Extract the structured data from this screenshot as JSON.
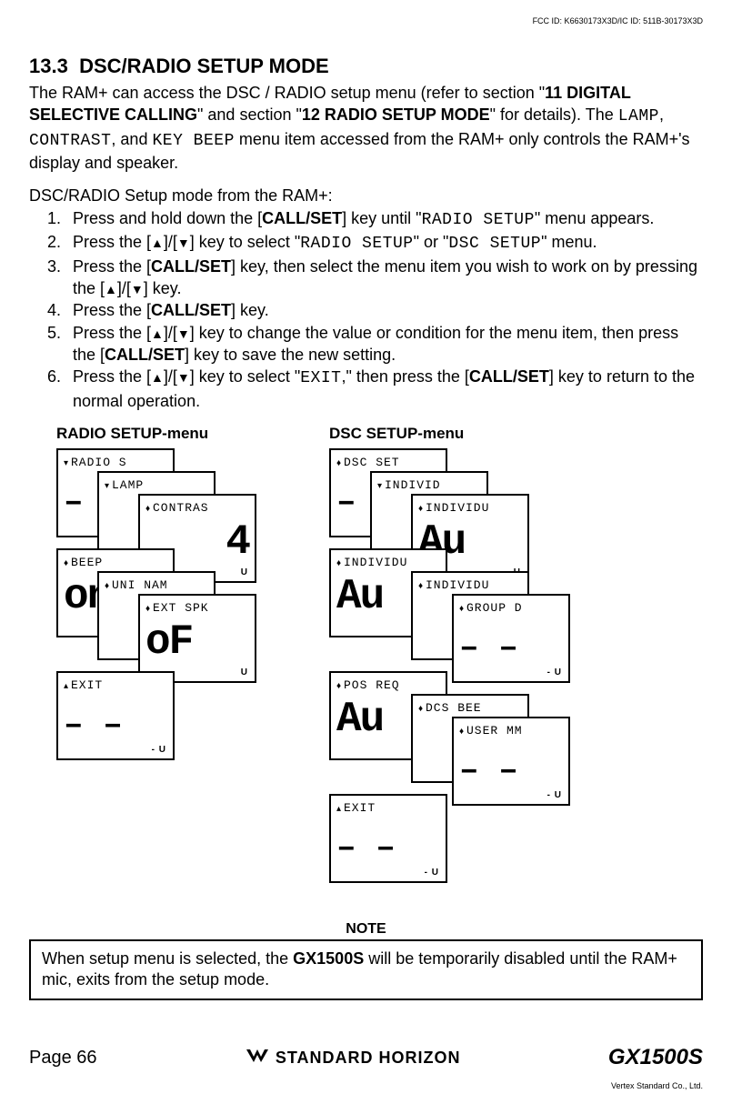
{
  "header": {
    "fcc_id": "FCC ID: K6630173X3D/IC ID: 511B-30173X3D"
  },
  "section": {
    "number": "13.3",
    "title": "DSC/RADIO SETUP MODE"
  },
  "intro": {
    "part1a": "The RAM+ can access the DSC / RADIO setup menu (refer to section \"",
    "sec11": "11 DIGITAL SELECTIVE CALLING",
    "part1b": "\" and section \"",
    "sec12": "12 RADIO SETUP MODE",
    "part1c": "\" for details). The ",
    "lamp": "LAMP",
    "comma1": ", ",
    "contrast": "CONTRAST",
    "part2": ", and ",
    "keybeep": "KEY BEEP",
    "part3": " menu item accessed from the RAM+ only controls the RAM+'s display and speaker."
  },
  "setup_from": "DSC/RADIO Setup mode from the RAM+:",
  "steps": {
    "s1a": "Press and hold down the [",
    "s1b": "CALL/SET",
    "s1c": "] key until \"",
    "s1d": "RADIO SETUP",
    "s1e": "\" menu appears.",
    "s2a": "Press the [",
    "s2b": "]/[",
    "s2c": "] key to select \"",
    "s2d": "RADIO SETUP",
    "s2e": "\" or \"",
    "s2f": "DSC SETUP",
    "s2g": "\" menu.",
    "s3a": "Press the [",
    "s3b": "CALL/SET",
    "s3c": "] key, then select the menu item you wish to work on by pressing the [",
    "s3d": "]/[",
    "s3e": "] key.",
    "s4a": "Press the [",
    "s4b": "CALL/SET",
    "s4c": "] key.",
    "s5a": "Press the [",
    "s5b": "]/[",
    "s5c": "] key to change the value or condition for the menu item, then press the [",
    "s5d": "CALL/SET",
    "s5e": "] key to save the new setting.",
    "s6a": "Press the [",
    "s6b": "]/[",
    "s6c": "] key to select \"",
    "s6d": "EXIT",
    "s6e": ",\" then press the [",
    "s6f": "CALL/SET",
    "s6g": "] key to return to the normal operation."
  },
  "arrows": {
    "up": "▲",
    "down": "▼"
  },
  "diagrams": {
    "radio_title": "RADIO SETUP-menu",
    "dsc_title": "DSC SETUP-menu",
    "radio_panels": {
      "radio_s": "RADIO S",
      "lamp": "LAMP",
      "contras": "CONTRAS",
      "contras_val": "4",
      "beep": "BEEP",
      "beep_val": "on",
      "uni_nam": "UNI NAM",
      "ext_spk": "EXT SPK",
      "ext_spk_val": "oF",
      "exit": "EXIT"
    },
    "dsc_panels": {
      "dsc_set": "DSC SET",
      "individ1": "INDIVID",
      "individu1": "INDIVIDU",
      "individu_val": "Au",
      "individu2": "INDIVIDU",
      "individu2_val": "Au",
      "individu3": "INDIVIDU",
      "group_d": "GROUP D",
      "pos_req": "POS REQ",
      "pos_req_val": "Au",
      "dcs_bee": "DCS BEE",
      "user_mm": "USER MM",
      "exit": "EXIT"
    },
    "u_mark": "U",
    "dash": "– –"
  },
  "note": {
    "label": "NOTE",
    "text_a": "When setup menu is selected, the ",
    "model": "GX1500S",
    "text_b": " will be temporarily disabled until the RAM+ mic, exits from the setup mode."
  },
  "footer": {
    "page": "Page 66",
    "brand": "STANDARD HORIZON",
    "model": "GX1500S",
    "vertex": "Vertex Standard Co., Ltd."
  }
}
